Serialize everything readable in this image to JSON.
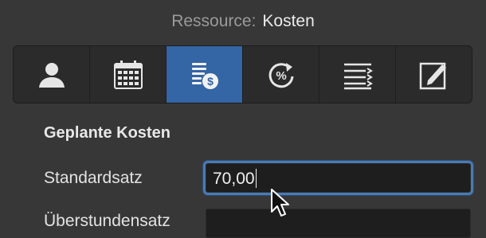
{
  "header": {
    "prefix": "Ressource:",
    "name": "Kosten"
  },
  "toolbar": {
    "items": [
      {
        "id": "person",
        "icon": "person-icon",
        "active": false
      },
      {
        "id": "calendar",
        "icon": "calendar-icon",
        "active": false
      },
      {
        "id": "cost",
        "icon": "cost-list-dollar-icon",
        "active": true
      },
      {
        "id": "percent",
        "icon": "percent-cycle-icon",
        "active": false
      },
      {
        "id": "list",
        "icon": "list-icon",
        "active": false
      },
      {
        "id": "notes",
        "icon": "edit-note-icon",
        "active": false
      }
    ],
    "accent": "#3465a4"
  },
  "section": {
    "title": "Geplante Kosten"
  },
  "fields": {
    "standard_label": "Standardsatz",
    "standard_value": "70,00",
    "overtime_label": "Überstundensatz",
    "overtime_value": ""
  },
  "colors": {
    "background": "#373737",
    "focus_ring": "#4a7ab3"
  }
}
